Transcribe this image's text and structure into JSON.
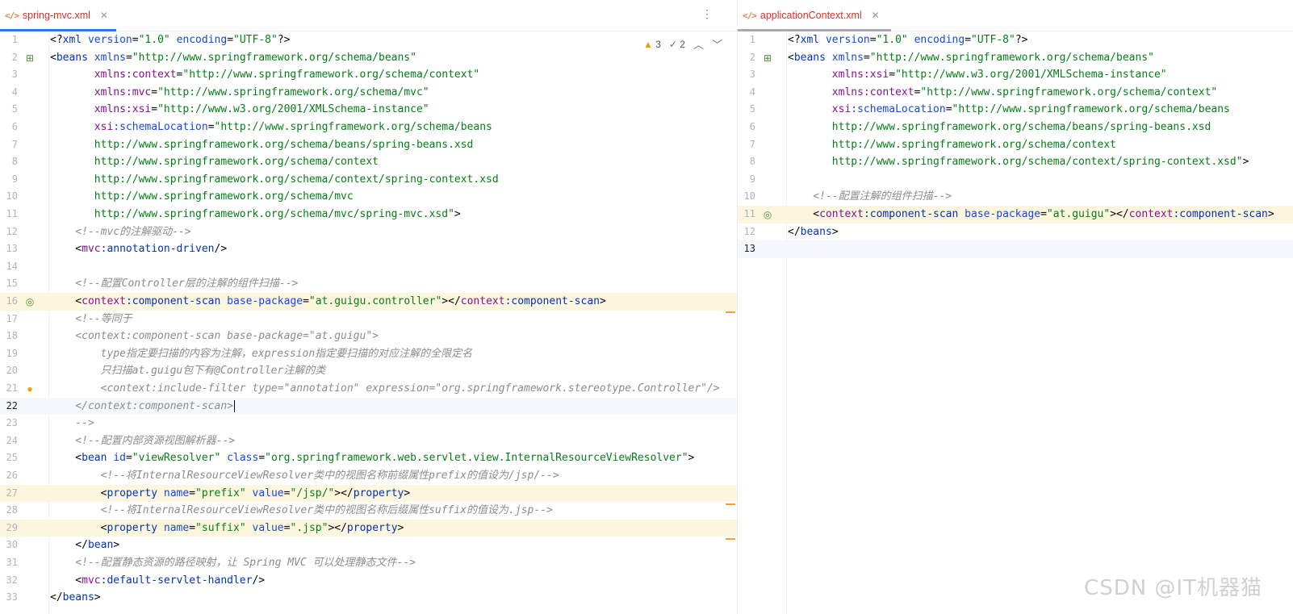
{
  "left_tab": {
    "label": "spring-mvc.xml",
    "icon": "xml-file-icon"
  },
  "right_tab": {
    "label": "applicationContext.xml",
    "icon": "xml-file-icon"
  },
  "inspection": {
    "warnings": "3",
    "weak_warnings": "2"
  },
  "watermark": "CSDN @IT机器猫",
  "left_lines": [
    [
      [
        "pct",
        "<?"
      ],
      [
        "tag",
        "xml"
      ],
      [
        "pct",
        " "
      ],
      [
        "attr",
        "version"
      ],
      [
        "pct",
        "="
      ],
      [
        "val",
        "\"1.0\""
      ],
      [
        "pct",
        " "
      ],
      [
        "attr",
        "encoding"
      ],
      [
        "pct",
        "="
      ],
      [
        "val",
        "\"UTF-8\""
      ],
      [
        "pct",
        "?>"
      ]
    ],
    [
      [
        "pct",
        "<"
      ],
      [
        "tag",
        "beans"
      ],
      [
        "pct",
        " "
      ],
      [
        "attr",
        "xmlns"
      ],
      [
        "pct",
        "="
      ],
      [
        "val",
        "\"http://www.springframework.org/schema/beans\""
      ]
    ],
    [
      [
        "pct",
        "       "
      ],
      [
        "ns",
        "xmlns:context"
      ],
      [
        "pct",
        "="
      ],
      [
        "val",
        "\"http://www.springframework.org/schema/context\""
      ]
    ],
    [
      [
        "pct",
        "       "
      ],
      [
        "ns",
        "xmlns:mvc"
      ],
      [
        "pct",
        "="
      ],
      [
        "val",
        "\"http://www.springframework.org/schema/mvc\""
      ]
    ],
    [
      [
        "pct",
        "       "
      ],
      [
        "ns",
        "xmlns:xsi"
      ],
      [
        "pct",
        "="
      ],
      [
        "val",
        "\"http://www.w3.org/2001/XMLSchema-instance\""
      ]
    ],
    [
      [
        "pct",
        "       "
      ],
      [
        "ns",
        "xsi"
      ],
      [
        "attr",
        ":schemaLocation"
      ],
      [
        "pct",
        "="
      ],
      [
        "val",
        "\"http://www.springframework.org/schema/beans"
      ]
    ],
    [
      [
        "val",
        "       http://www.springframework.org/schema/beans/spring-beans.xsd"
      ]
    ],
    [
      [
        "val",
        "       http://www.springframework.org/schema/context"
      ]
    ],
    [
      [
        "val",
        "       http://www.springframework.org/schema/context/spring-context.xsd"
      ]
    ],
    [
      [
        "val",
        "       http://www.springframework.org/schema/mvc"
      ]
    ],
    [
      [
        "val",
        "       http://www.springframework.org/schema/mvc/spring-mvc.xsd\""
      ],
      [
        "pct",
        ">"
      ]
    ],
    [
      [
        "cmt",
        "    <!--mvc的注解驱动-->"
      ]
    ],
    [
      [
        "pct",
        "    <"
      ],
      [
        "ns",
        "mvc"
      ],
      [
        "tag",
        ":annotation-driven"
      ],
      [
        "pct",
        "/>"
      ]
    ],
    [],
    [
      [
        "cmt",
        "    <!--配置Controller层的注解的组件扫描-->"
      ]
    ],
    [
      [
        "pct",
        "    <"
      ],
      [
        "ns",
        "context"
      ],
      [
        "tag",
        ":component-scan"
      ],
      [
        "pct",
        " "
      ],
      [
        "attr",
        "base-package"
      ],
      [
        "pct",
        "="
      ],
      [
        "val",
        "\"at.guigu.controller\""
      ],
      [
        "pct",
        "></"
      ],
      [
        "ns",
        "context"
      ],
      [
        "tag",
        ":component-scan"
      ],
      [
        "pct",
        ">"
      ]
    ],
    [
      [
        "cmt",
        "    <!--等同于"
      ]
    ],
    [
      [
        "cmt",
        "    <context:component-scan base-package=\"at.guigu\">"
      ]
    ],
    [
      [
        "cmt",
        "        type指定要扫描的内容为注解，expression指定要扫描的对应注解的全限定名"
      ]
    ],
    [
      [
        "cmt",
        "        只扫描at.guigu包下有@Controller注解的类"
      ]
    ],
    [
      [
        "cmt",
        "        <context:include-filter type=\"annotation\" expression=\"org.springframework.stereotype.Controller\"/>"
      ]
    ],
    [
      [
        "cmt",
        "    </context:component-scan>"
      ]
    ],
    [
      [
        "cmt",
        "    -->"
      ]
    ],
    [
      [
        "cmt",
        "    <!--配置内部资源视图解析器-->"
      ]
    ],
    [
      [
        "pct",
        "    <"
      ],
      [
        "tag",
        "bean"
      ],
      [
        "pct",
        " "
      ],
      [
        "attr",
        "id"
      ],
      [
        "pct",
        "="
      ],
      [
        "val",
        "\"viewResolver\""
      ],
      [
        "pct",
        " "
      ],
      [
        "attr",
        "class"
      ],
      [
        "pct",
        "="
      ],
      [
        "val",
        "\"org.springframework.web.servlet.view.InternalResourceViewResolver\""
      ],
      [
        "pct",
        ">"
      ]
    ],
    [
      [
        "cmt",
        "        <!--将InternalResourceViewResolver类中的视图名称前缀属性prefix的值设为/jsp/-->"
      ]
    ],
    [
      [
        "pct",
        "        <"
      ],
      [
        "tag",
        "property"
      ],
      [
        "pct",
        " "
      ],
      [
        "attr",
        "name"
      ],
      [
        "pct",
        "="
      ],
      [
        "val",
        "\"prefix\""
      ],
      [
        "pct",
        " "
      ],
      [
        "attr",
        "value"
      ],
      [
        "pct",
        "="
      ],
      [
        "val",
        "\"/jsp/\""
      ],
      [
        "pct",
        "></"
      ],
      [
        "tag",
        "property"
      ],
      [
        "pct",
        ">"
      ]
    ],
    [
      [
        "cmt",
        "        <!--将InternalResourceViewResolver类中的视图名称后缀属性suffix的值设为.jsp-->"
      ]
    ],
    [
      [
        "pct",
        "        <"
      ],
      [
        "tag",
        "property"
      ],
      [
        "pct",
        " "
      ],
      [
        "attr",
        "name"
      ],
      [
        "pct",
        "="
      ],
      [
        "val",
        "\"suffix\""
      ],
      [
        "pct",
        " "
      ],
      [
        "attr",
        "value"
      ],
      [
        "pct",
        "="
      ],
      [
        "val",
        "\".jsp\""
      ],
      [
        "pct",
        "></"
      ],
      [
        "tag",
        "property"
      ],
      [
        "pct",
        ">"
      ]
    ],
    [
      [
        "pct",
        "    </"
      ],
      [
        "tag",
        "bean"
      ],
      [
        "pct",
        ">"
      ]
    ],
    [
      [
        "cmt",
        "    <!--配置静态资源的路径映射，让 Spring MVC 可以处理静态文件-->"
      ]
    ],
    [
      [
        "pct",
        "    <"
      ],
      [
        "ns",
        "mvc"
      ],
      [
        "tag",
        ":default-servlet-handler"
      ],
      [
        "pct",
        "/>"
      ]
    ],
    [
      [
        "pct",
        "</"
      ],
      [
        "tag",
        "beans"
      ],
      [
        "pct",
        ">"
      ]
    ]
  ],
  "right_lines": [
    [
      [
        "pct",
        "<?"
      ],
      [
        "tag",
        "xml"
      ],
      [
        "pct",
        " "
      ],
      [
        "attr",
        "version"
      ],
      [
        "pct",
        "="
      ],
      [
        "val",
        "\"1.0\""
      ],
      [
        "pct",
        " "
      ],
      [
        "attr",
        "encoding"
      ],
      [
        "pct",
        "="
      ],
      [
        "val",
        "\"UTF-8\""
      ],
      [
        "pct",
        "?>"
      ]
    ],
    [
      [
        "pct",
        "<"
      ],
      [
        "tag",
        "beans"
      ],
      [
        "pct",
        " "
      ],
      [
        "attr",
        "xmlns"
      ],
      [
        "pct",
        "="
      ],
      [
        "val",
        "\"http://www.springframework.org/schema/beans\""
      ]
    ],
    [
      [
        "pct",
        "       "
      ],
      [
        "ns",
        "xmlns:xsi"
      ],
      [
        "pct",
        "="
      ],
      [
        "val",
        "\"http://www.w3.org/2001/XMLSchema-instance\""
      ]
    ],
    [
      [
        "pct",
        "       "
      ],
      [
        "ns",
        "xmlns:context"
      ],
      [
        "pct",
        "="
      ],
      [
        "val",
        "\"http://www.springframework.org/schema/context\""
      ]
    ],
    [
      [
        "pct",
        "       "
      ],
      [
        "ns",
        "xsi"
      ],
      [
        "attr",
        ":schemaLocation"
      ],
      [
        "pct",
        "="
      ],
      [
        "val",
        "\"http://www.springframework.org/schema/beans"
      ]
    ],
    [
      [
        "val",
        "       http://www.springframework.org/schema/beans/spring-beans.xsd"
      ]
    ],
    [
      [
        "val",
        "       http://www.springframework.org/schema/context"
      ]
    ],
    [
      [
        "val",
        "       http://www.springframework.org/schema/context/spring-context.xsd\""
      ],
      [
        "pct",
        ">"
      ]
    ],
    [],
    [
      [
        "cmt",
        "    <!--配置注解的组件扫描-->"
      ]
    ],
    [
      [
        "pct",
        "    <"
      ],
      [
        "ns",
        "context"
      ],
      [
        "tag",
        ":component-scan"
      ],
      [
        "pct",
        " "
      ],
      [
        "attr",
        "base-package"
      ],
      [
        "pct",
        "="
      ],
      [
        "val",
        "\"at.guigu\""
      ],
      [
        "pct",
        "></"
      ],
      [
        "ns",
        "context"
      ],
      [
        "tag",
        ":component-scan"
      ],
      [
        "pct",
        ">"
      ]
    ],
    [
      [
        "pct",
        "</"
      ],
      [
        "tag",
        "beans"
      ],
      [
        "pct",
        ">"
      ]
    ],
    []
  ]
}
